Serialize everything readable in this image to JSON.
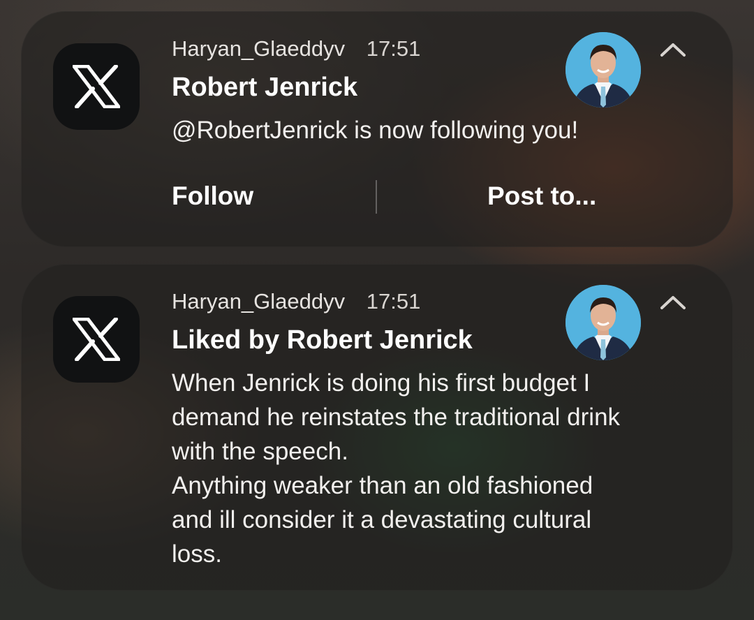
{
  "notifications": [
    {
      "app_icon": "x-logo-icon",
      "account": "Haryan_Glaeddyv",
      "time": "17:51",
      "title": "Robert Jenrick",
      "body": "@RobertJenrick is now following you!",
      "avatar": "profile-photo",
      "collapse_icon": "chevron-up-icon",
      "actions": [
        "Follow",
        "Post to..."
      ]
    },
    {
      "app_icon": "x-logo-icon",
      "account": "Haryan_Glaeddyv",
      "time": "17:51",
      "title": "Liked by Robert Jenrick",
      "body_lines": [
        "When Jenrick is doing his first budget I",
        "demand he reinstates the traditional drink",
        "with the speech.",
        "Anything weaker than an old fashioned",
        "and ill consider it a devastating cultural",
        "loss."
      ],
      "avatar": "profile-photo",
      "collapse_icon": "chevron-up-icon"
    }
  ],
  "colors": {
    "card_bg": "#22201f",
    "icon_bg": "#111213",
    "avatar_bg": "#54b3df",
    "text": "#ffffff"
  }
}
